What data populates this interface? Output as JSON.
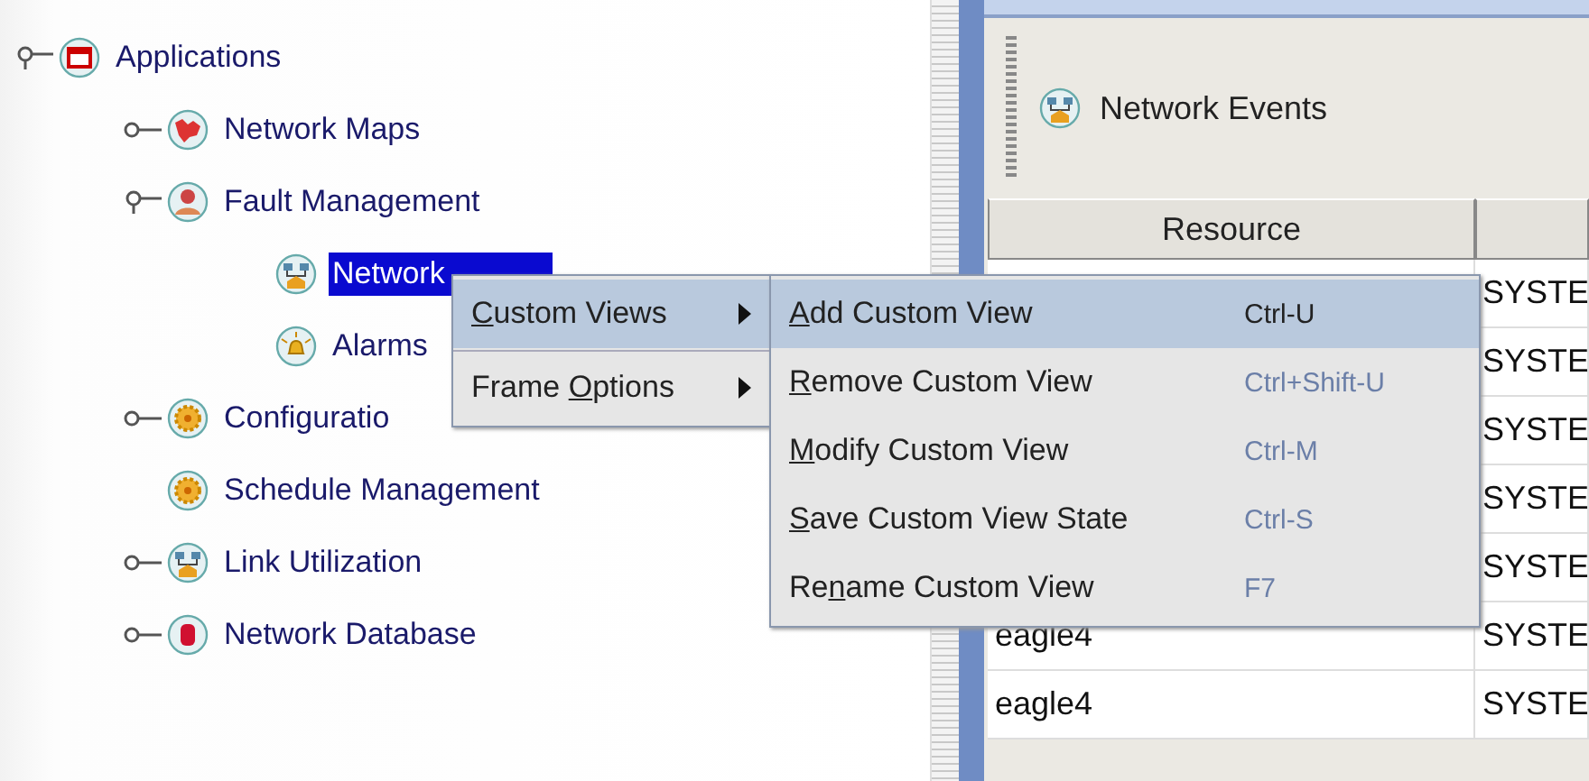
{
  "tree": [
    {
      "label": "Applications",
      "kind": "window",
      "expanded": true,
      "selected": false,
      "children": [
        {
          "label": "Network Maps",
          "kind": "map",
          "expanded": false,
          "selected": false
        },
        {
          "label": "Fault Management",
          "kind": "fault",
          "expanded": true,
          "selected": false,
          "children": [
            {
              "label": "Network",
              "kind": "events",
              "selected": true
            },
            {
              "label": "Alarms",
              "kind": "alarm",
              "selected": false
            }
          ]
        },
        {
          "label": "Configuratio",
          "kind": "gear",
          "expanded": false,
          "selected": false
        },
        {
          "label": "Schedule Management",
          "kind": "gear",
          "selected": false
        },
        {
          "label": "Link Utilization",
          "kind": "events",
          "expanded": false,
          "selected": false
        },
        {
          "label": "Network Database",
          "kind": "database",
          "expanded": false,
          "selected": false
        }
      ]
    }
  ],
  "toolbar": {
    "label": "Network Events"
  },
  "table": {
    "columns": [
      "Resource"
    ],
    "rows": [
      {
        "column_2": "SYSTE"
      },
      {
        "column_2": "SYSTE"
      },
      {
        "column_2": "SYSTE"
      },
      {
        "column_2": "SYSTE"
      },
      {
        "column_2": "SYSTE"
      },
      {
        "resource": "eagle4",
        "column_2": "SYSTE"
      },
      {
        "resource": "eagle4",
        "column_2": "SYSTE"
      }
    ]
  },
  "context_menu": [
    {
      "key": "C",
      "post": "ustom Views",
      "selected": true
    },
    {
      "pre": "Frame ",
      "key": "O",
      "post": "ptions",
      "selected": false
    }
  ],
  "submenu": [
    {
      "key": "A",
      "post": "dd Custom View",
      "shortcut": "Ctrl-U",
      "selected": true
    },
    {
      "key": "R",
      "post": "emove Custom View",
      "shortcut": "Ctrl+Shift-U",
      "selected": false
    },
    {
      "key": "M",
      "post": "odify Custom View",
      "shortcut": "Ctrl-M",
      "selected": false
    },
    {
      "key": "S",
      "post": "ave Custom View State",
      "shortcut": "Ctrl-S",
      "selected": false
    },
    {
      "pre": "Re",
      "key": "n",
      "post": "ame Custom View",
      "shortcut": "F7",
      "selected": false
    }
  ]
}
